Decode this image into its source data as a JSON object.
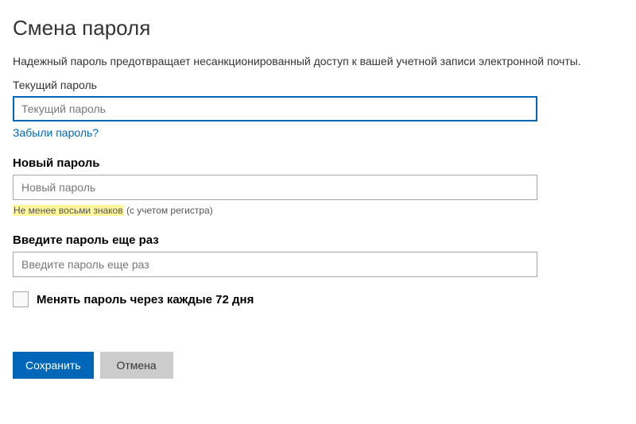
{
  "header": {
    "title": "Смена пароля",
    "description": "Надежный пароль предотвращает несанкционированный доступ к вашей учетной записи электронной почты."
  },
  "fields": {
    "current": {
      "label": "Текущий пароль",
      "placeholder": "Текущий пароль",
      "forgot_link": "Забыли пароль?"
    },
    "new": {
      "label": "Новый пароль",
      "placeholder": "Новый пароль",
      "hint_highlight": "Не менее восьми знаков",
      "hint_rest": " (с учетом регистра)"
    },
    "confirm": {
      "label": "Введите пароль еще раз",
      "placeholder": "Введите пароль еще раз"
    }
  },
  "checkbox": {
    "label": "Менять пароль через каждые 72 дня"
  },
  "buttons": {
    "save": "Сохранить",
    "cancel": "Отмена"
  }
}
